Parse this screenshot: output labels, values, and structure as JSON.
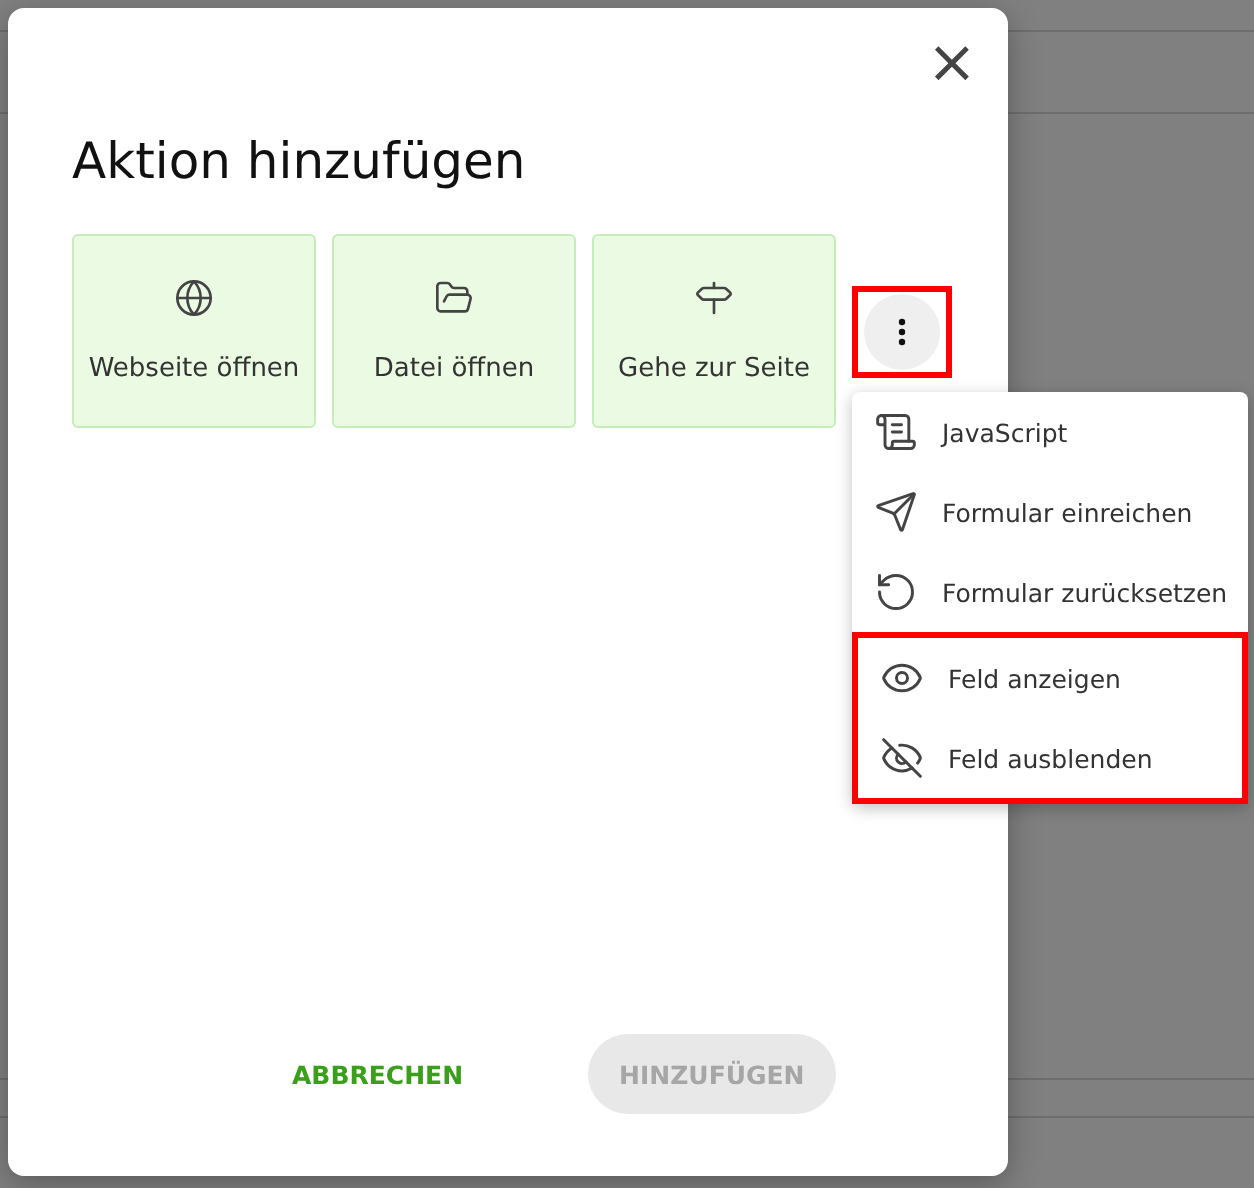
{
  "dialog": {
    "title": "Aktion hinzufügen",
    "close": "×",
    "actions": [
      {
        "label": "Webseite öffnen"
      },
      {
        "label": "Datei öffnen"
      },
      {
        "label": "Gehe zur Seite"
      }
    ],
    "more_button": {
      "highlighted": true
    },
    "menu": [
      {
        "label": "JavaScript",
        "highlighted": false
      },
      {
        "label": "Formular einreichen",
        "highlighted": false
      },
      {
        "label": "Formular zurücksetzen",
        "highlighted": false
      },
      {
        "label": "Feld anzeigen",
        "highlighted": true
      },
      {
        "label": "Feld ausblenden",
        "highlighted": true
      }
    ],
    "buttons": [
      {
        "label": "ABBRECHEN",
        "kind": "text",
        "disabled": false
      },
      {
        "label": "HINZUFÜGEN",
        "kind": "filled",
        "disabled": true
      }
    ]
  }
}
